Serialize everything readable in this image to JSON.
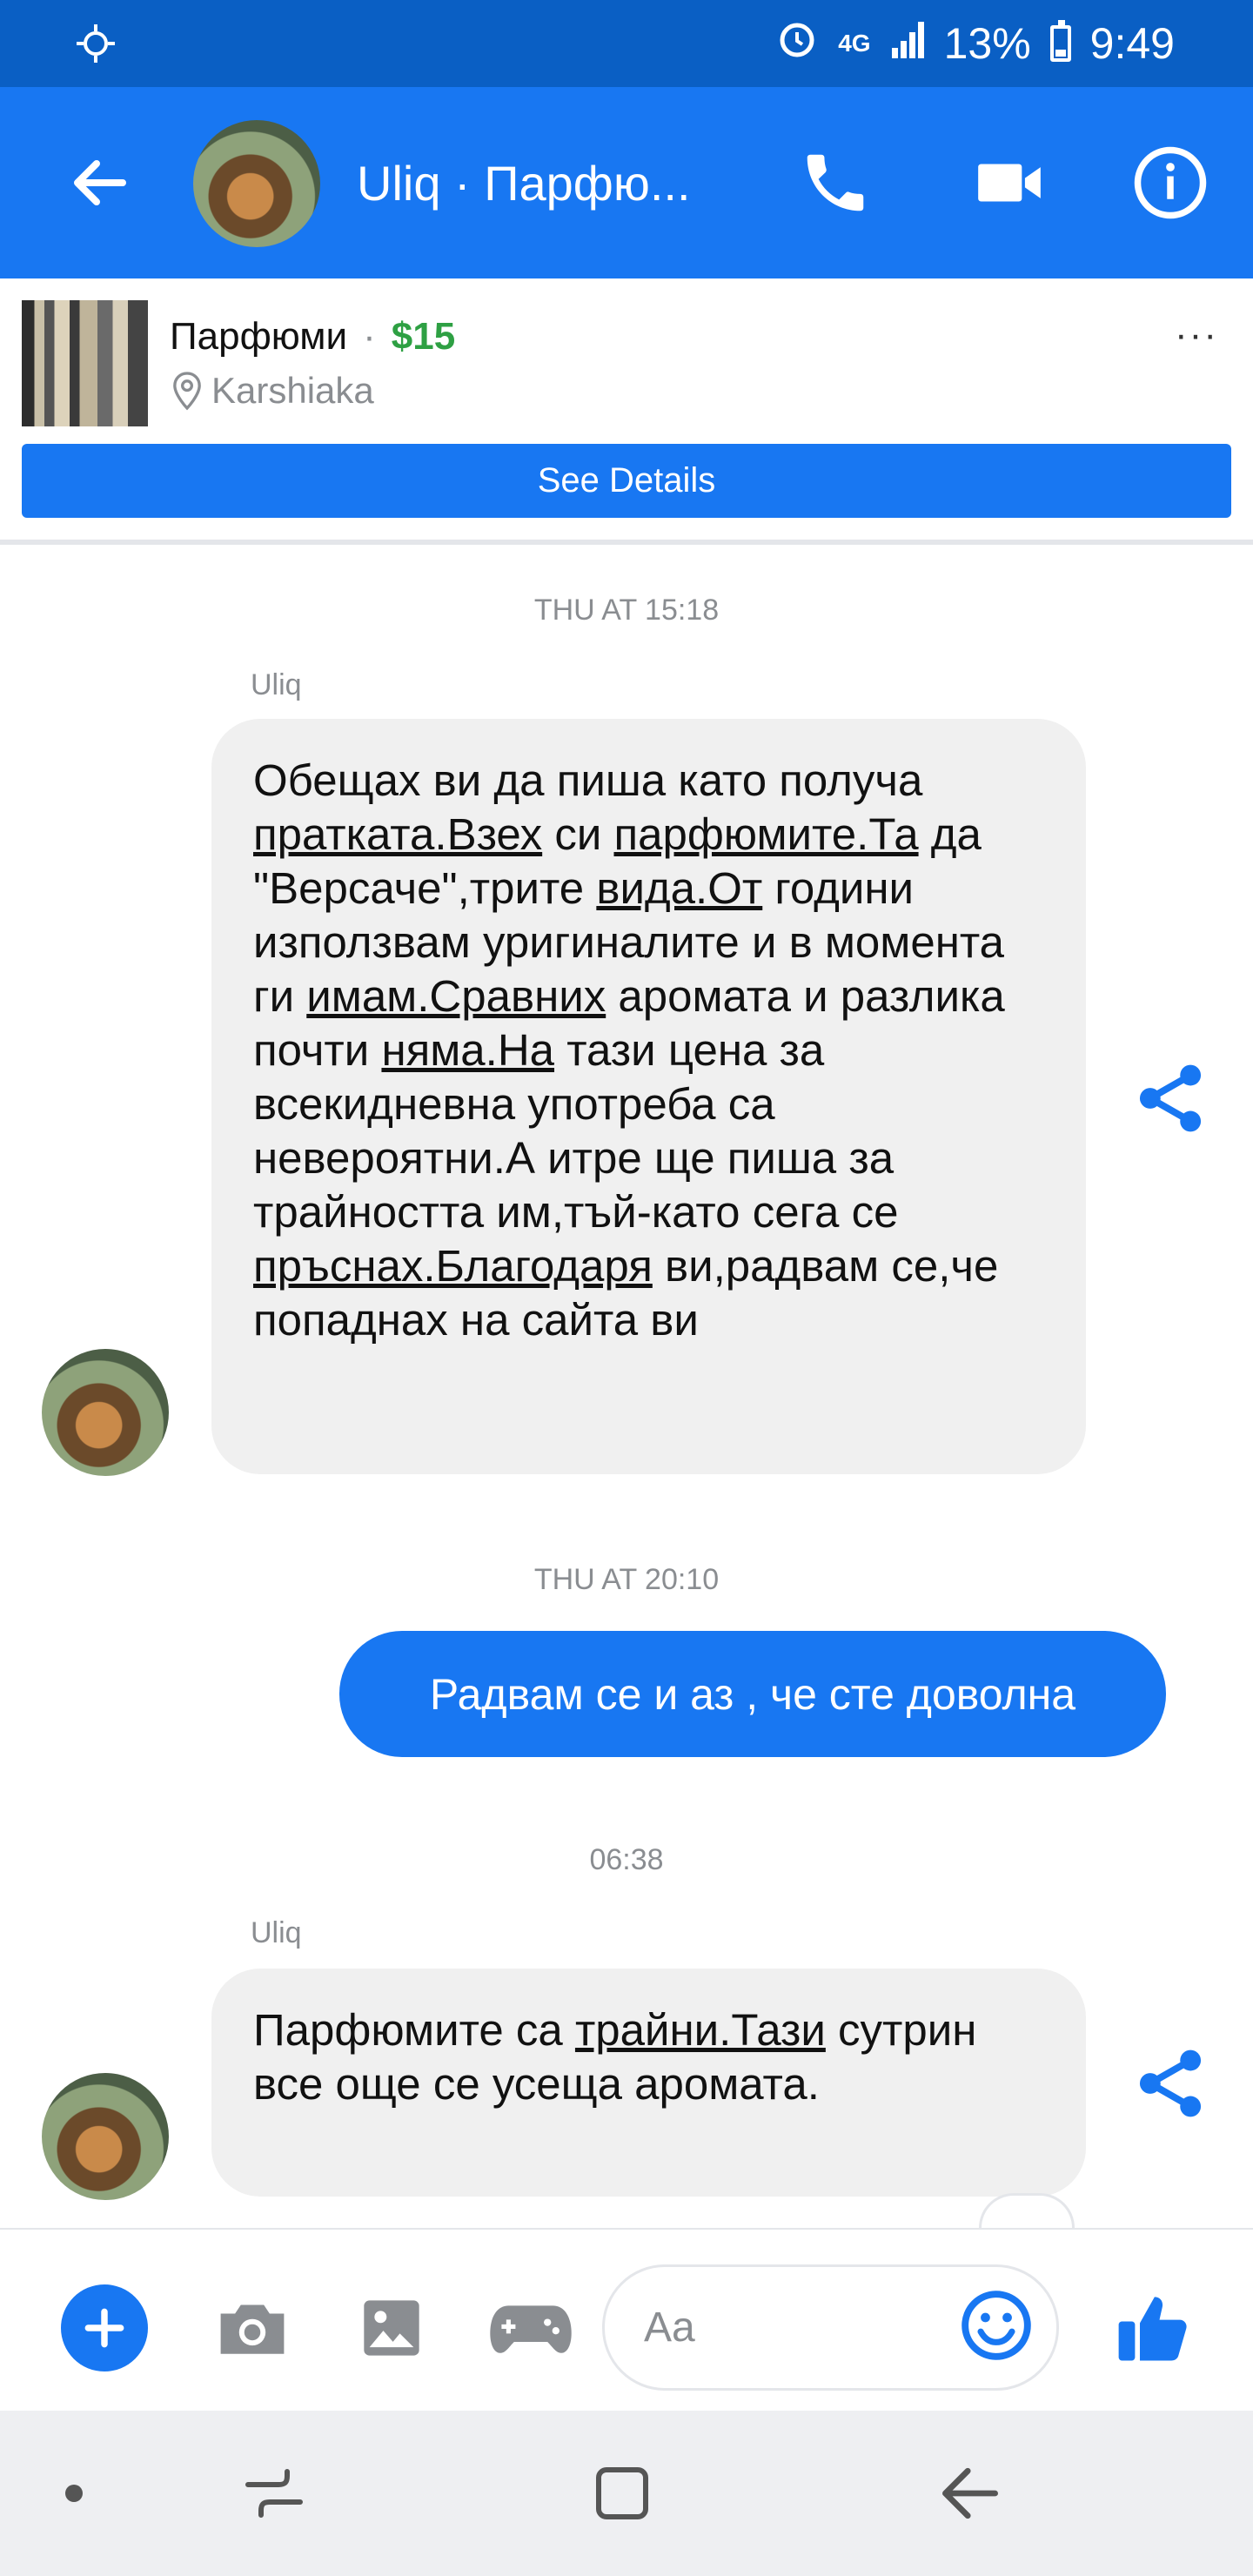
{
  "status_bar": {
    "network": "4G",
    "battery": "13%",
    "time": "9:49"
  },
  "header": {
    "title": "Uliq · Парфю..."
  },
  "listing": {
    "title": "Парфюми",
    "separator": "·",
    "price": "$15",
    "location": "Karshiaka",
    "more": "···",
    "button_label": "See Details"
  },
  "conversation": {
    "timestamp_1": "THU AT 15:18",
    "sender_1": "Uliq",
    "message_1": {
      "parts": [
        "Обещах ви да пиша като получа ",
        "пратката.Взех",
        " си ",
        "парфюмите.Та",
        " да \"Версаче\",трите ",
        "вида.От",
        " години използвам уригиналите и в момента ги ",
        "имам.Сравних",
        " аромата и разлика почти ",
        "няма.На",
        " тази цена за всекидневна употреба са невероятни.А итре ще пиша за трайността им,тъй-като сега се ",
        "пръснах.Благодаря",
        " ви,радвам се,че попаднах на сайта ви"
      ]
    },
    "timestamp_2": "THU AT 20:10",
    "message_2": "Радвам се и аз , че сте доволна",
    "timestamp_3": "06:38",
    "sender_3": "Uliq",
    "message_3": {
      "parts": [
        "Парфюмите са ",
        "трайни.Тази",
        " сутрин все още се усеща аромата."
      ]
    }
  },
  "composer": {
    "placeholder": "Aa"
  },
  "colors": {
    "accent": "#1877f2",
    "status_bar": "#0a5fc4",
    "incoming_bubble": "#f0f0f0",
    "price": "#2ea043"
  },
  "icons": [
    "back-arrow-icon",
    "phone-icon",
    "video-camera-icon",
    "info-icon",
    "location-pin-icon",
    "share-icon",
    "plus-icon",
    "camera-icon",
    "image-icon",
    "gamepad-icon",
    "emoji-icon",
    "thumbs-up-icon",
    "recents-icon",
    "home-icon",
    "back-nav-icon"
  ]
}
